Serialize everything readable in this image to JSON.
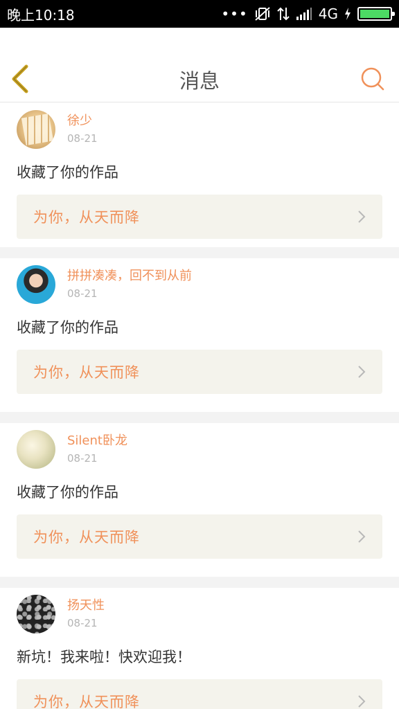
{
  "status_bar": {
    "time": "晚上10:18",
    "network": "4G",
    "battery_color": "#4cd964"
  },
  "header": {
    "title": "消息",
    "back_icon": "back-chevron-icon",
    "search_icon": "search-icon",
    "accent_color": "#f0915a"
  },
  "messages": [
    {
      "username": "徐少",
      "date": "08-21",
      "text": "收藏了你的作品",
      "work_title": "为你，从天而降"
    },
    {
      "username": "拼拼凑凑，回不到从前",
      "date": "08-21",
      "text": "收藏了你的作品",
      "work_title": "为你，从天而降"
    },
    {
      "username": "Silent卧龙",
      "date": "08-21",
      "text": "收藏了你的作品",
      "work_title": "为你，从天而降"
    },
    {
      "username": "扬天性",
      "date": "08-21",
      "text": "新坑！我来啦！快欢迎我！",
      "work_title": "为你，从天而降"
    }
  ]
}
